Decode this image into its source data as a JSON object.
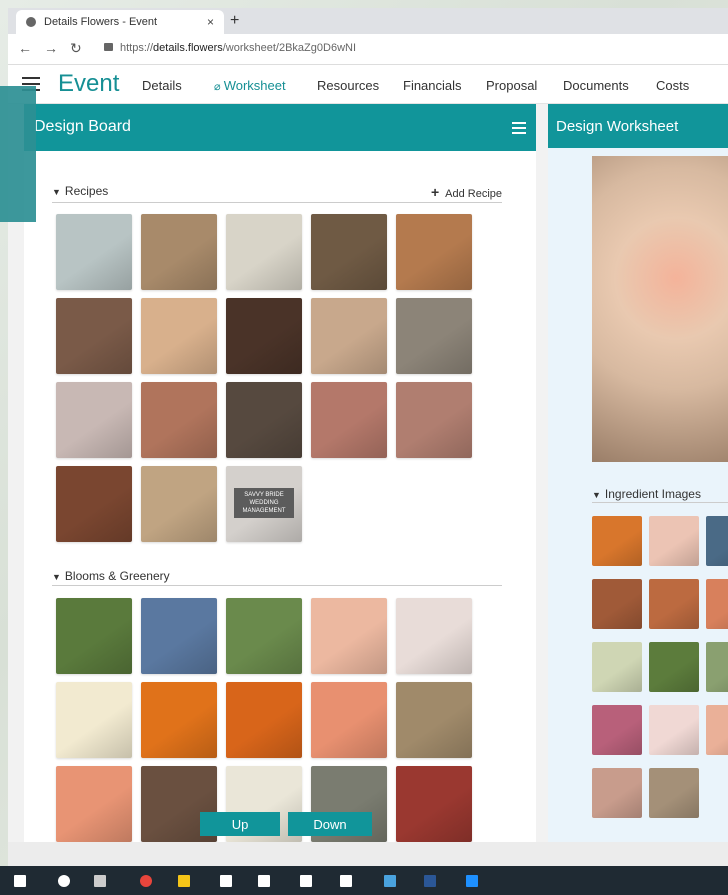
{
  "browser": {
    "tab_title": "Details Flowers - Event",
    "close_glyph": "×",
    "new_tab_glyph": "+",
    "url_prefix": "https://",
    "url_domain": "details.flowers",
    "url_path": "/worksheet/2BkaZg0D6wNI"
  },
  "app": {
    "title": "Event",
    "nav": [
      "Details",
      "Worksheet",
      "Resources",
      "Financials",
      "Proposal",
      "Documents",
      "Costs"
    ]
  },
  "design_board": {
    "title": "Design Board",
    "recipes_label": "Recipes",
    "add_recipe_label": "Add Recipe",
    "add_recipe_glyph": "+",
    "blooms_label": "Blooms & Greenery",
    "recipe_thumb_label": "SAVVY BRIDE WEDDING MANAGEMENT",
    "up_label": "Up",
    "down_label": "Down",
    "recipe_colors": [
      "#b8c4c4",
      "#a88a6a",
      "#d8d4c8",
      "#6f5a44",
      "#b47a4e",
      "#7a5a48",
      "#d8b08c",
      "#4a3328",
      "#c8a88c",
      "#8c8478",
      "#c8b8b4",
      "#b0745c",
      "#56493f",
      "#b4786a",
      "#b07e70",
      "#7a4630",
      "#c0a482",
      "#d4d0cc"
    ],
    "bloom_colors": [
      "#5a7a3c",
      "#5a78a0",
      "#6a8a4c",
      "#ecb8a0",
      "#e8dcd8",
      "#f2ead0",
      "#e0721a",
      "#d8651a",
      "#e89070",
      "#a08a6a",
      "#e89474",
      "#6a5040",
      "#eae6d8",
      "#7a7c70",
      "#9a3830"
    ]
  },
  "design_worksheet": {
    "title": "Design Worksheet",
    "ingredient_label": "Ingredient Images",
    "ingredient_colors": [
      "#d8762c",
      "#ecc4b4",
      "#4a6a86",
      "#a05a38",
      "#bc6a40",
      "#d8805c",
      "#cfd6b4",
      "#5c7c3c",
      "#8aa070",
      "#b8607a",
      "#f0d8d4",
      "#eab098",
      "#c89c8c",
      "#a49078"
    ]
  },
  "taskbar": {
    "icons": [
      "windows-icon",
      "search-icon",
      "task-view-icon",
      "chrome-icon",
      "file-explorer-icon",
      "store-icon",
      "dropbox-icon",
      "calendar-icon",
      "mail-icon",
      "app-icon",
      "word-icon",
      "edge-icon"
    ]
  }
}
